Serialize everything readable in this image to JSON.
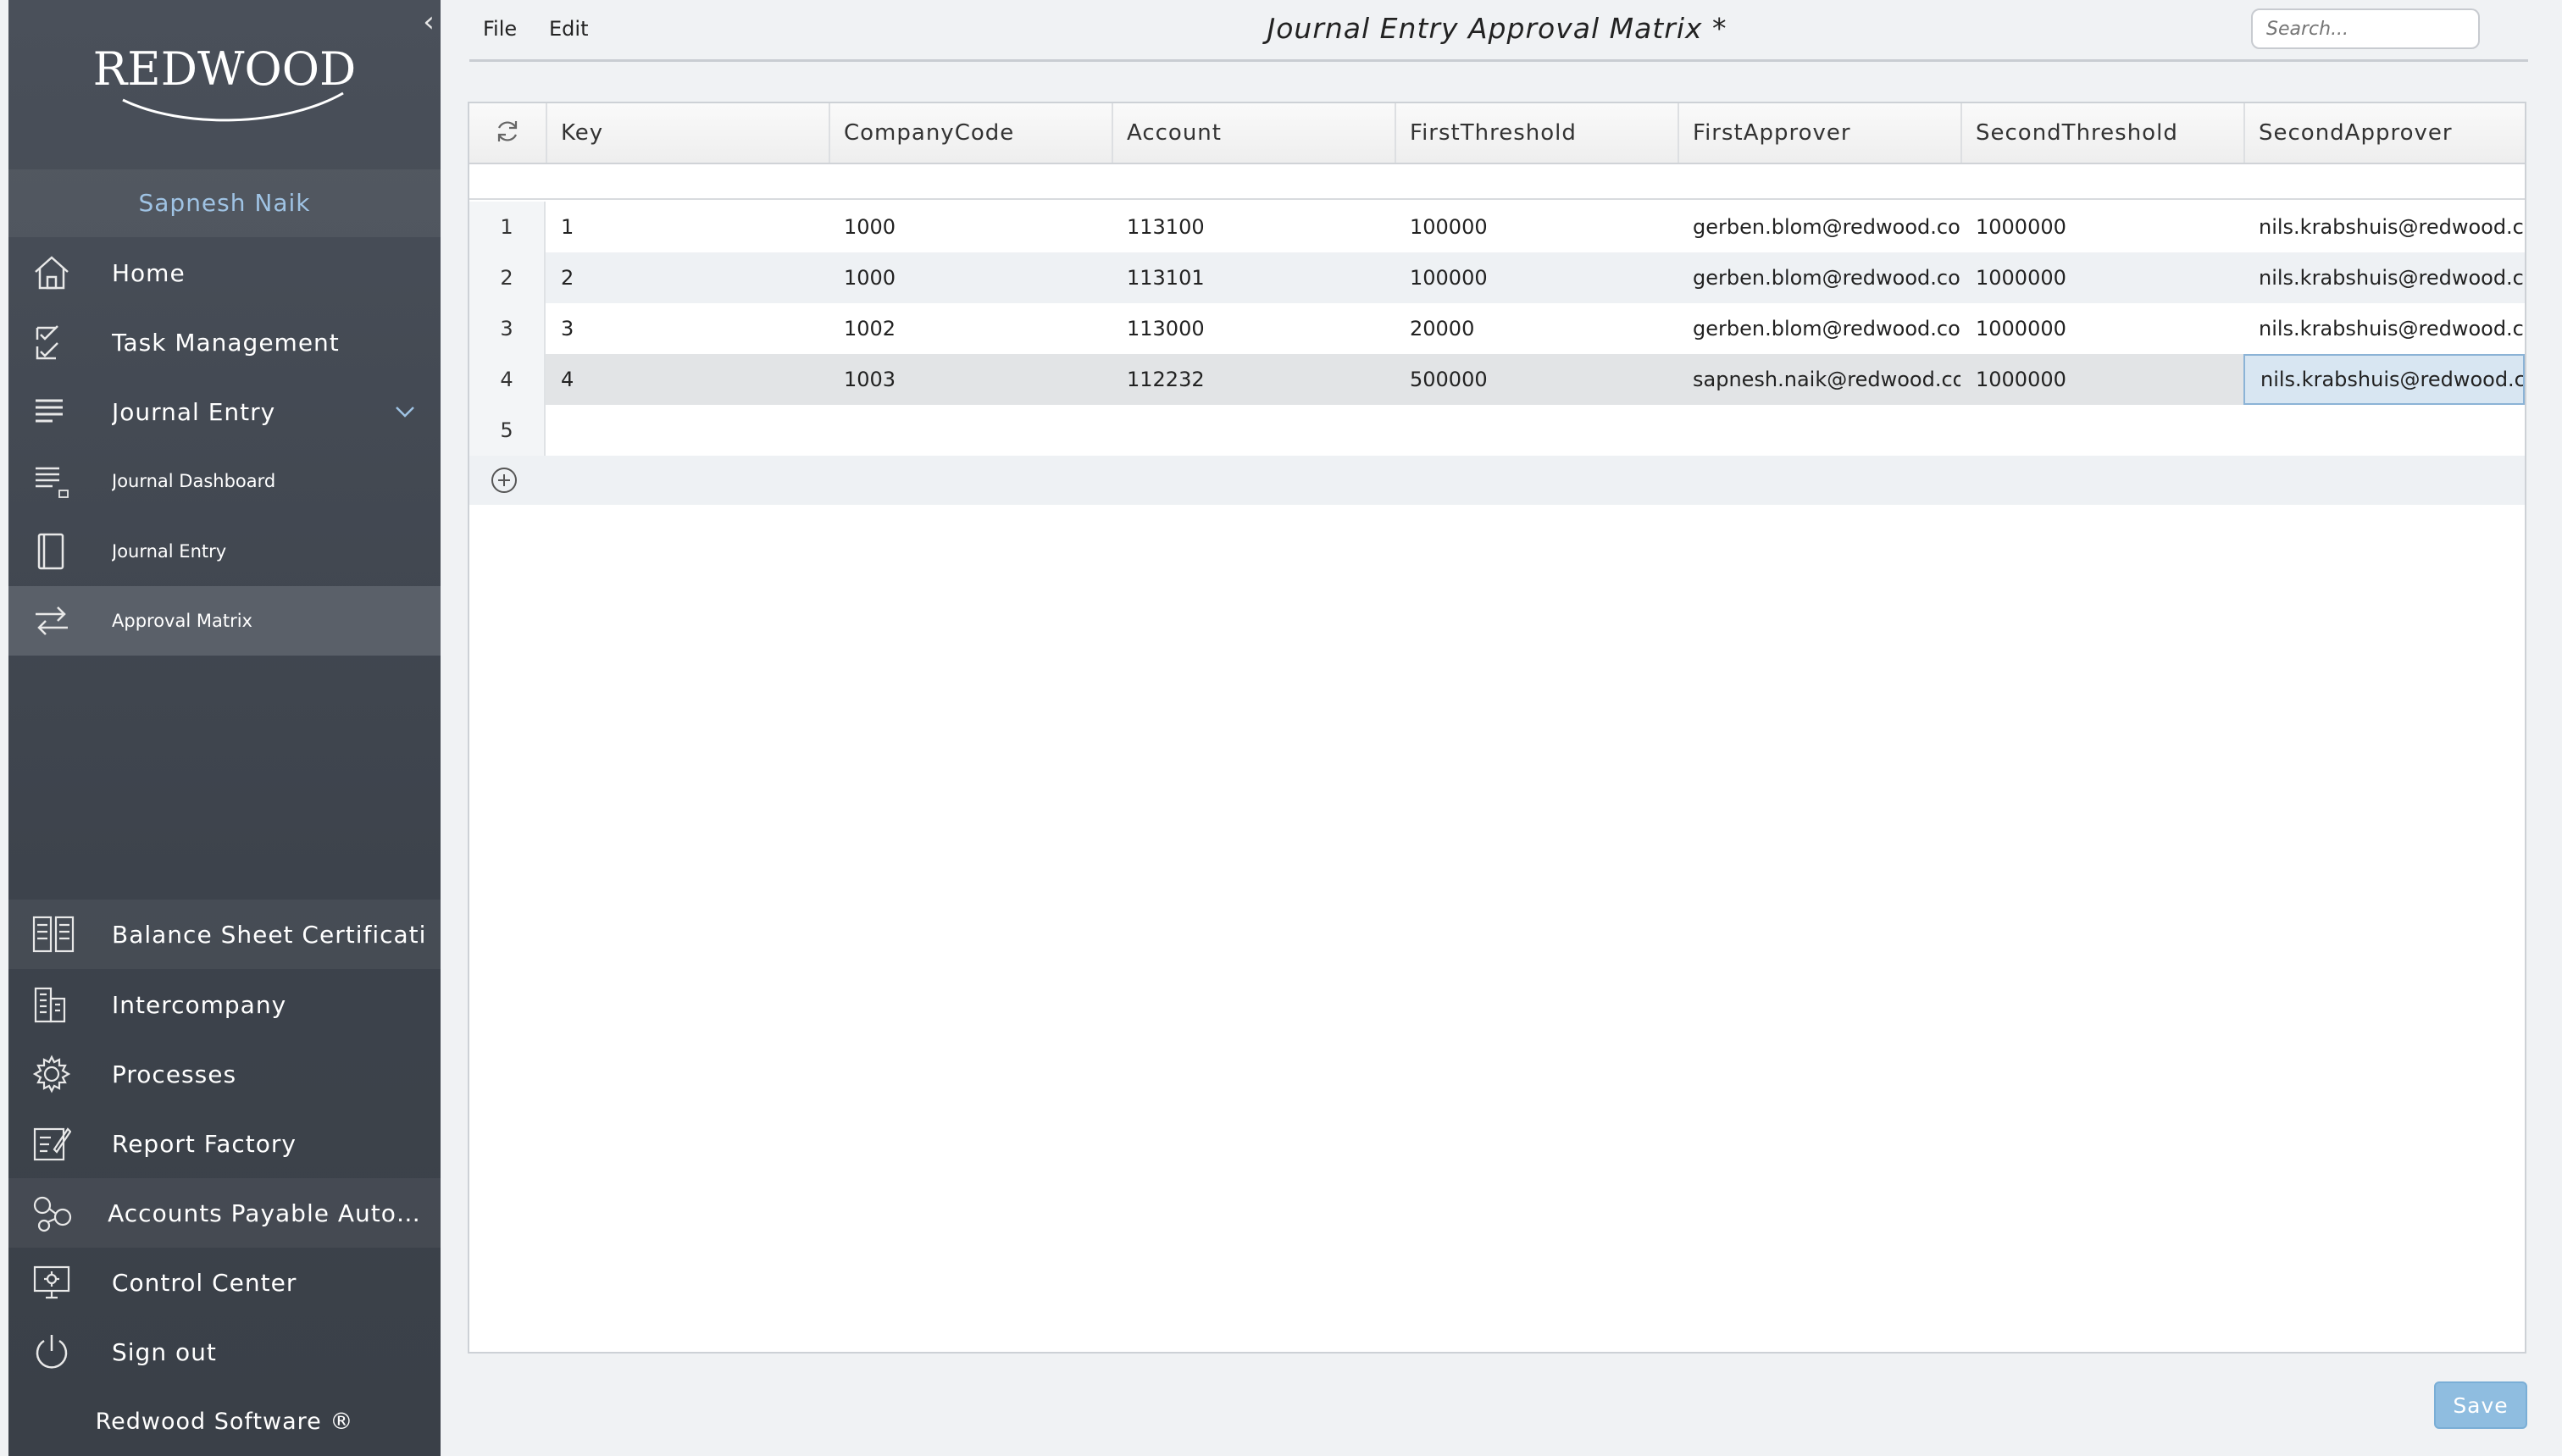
{
  "sidebar": {
    "brand": "REDWOOD",
    "user_name": "Sapnesh Naik",
    "items": [
      {
        "label": "Home"
      },
      {
        "label": "Task Management"
      },
      {
        "label": "Journal Entry"
      },
      {
        "label": "Journal Dashboard"
      },
      {
        "label": "Journal Entry"
      },
      {
        "label": "Approval Matrix"
      },
      {
        "label": "Balance Sheet Certificati"
      },
      {
        "label": "Intercompany"
      },
      {
        "label": "Processes"
      },
      {
        "label": "Report Factory"
      },
      {
        "label": "Accounts Payable Autom..."
      },
      {
        "label": "Control Center"
      },
      {
        "label": "Sign out"
      }
    ],
    "footer": "Redwood Software ®"
  },
  "toolbar": {
    "file_label": "File",
    "edit_label": "Edit",
    "title": "Journal Entry Approval Matrix *",
    "search_placeholder": "Search..."
  },
  "table": {
    "columns": [
      "Key",
      "CompanyCode",
      "Account",
      "FirstThreshold",
      "FirstApprover",
      "SecondThreshold",
      "SecondApprover"
    ],
    "rows": [
      {
        "num": "1",
        "cells": [
          "1",
          "1000",
          "113100",
          "100000",
          "gerben.blom@redwood.com",
          "1000000",
          "nils.krabshuis@redwood.com"
        ]
      },
      {
        "num": "2",
        "cells": [
          "2",
          "1000",
          "113101",
          "100000",
          "gerben.blom@redwood.com",
          "1000000",
          "nils.krabshuis@redwood.com"
        ]
      },
      {
        "num": "3",
        "cells": [
          "3",
          "1002",
          "113000",
          "20000",
          "gerben.blom@redwood.com",
          "1000000",
          "nils.krabshuis@redwood.com"
        ]
      },
      {
        "num": "4",
        "cells": [
          "4",
          "1003",
          "112232",
          "500000",
          "sapnesh.naik@redwood.com",
          "1000000",
          "nils.krabshuis@redwood.com"
        ]
      },
      {
        "num": "5",
        "cells": [
          "",
          "",
          "",
          "",
          "",
          "",
          ""
        ]
      }
    ]
  },
  "actions": {
    "save_label": "Save"
  }
}
